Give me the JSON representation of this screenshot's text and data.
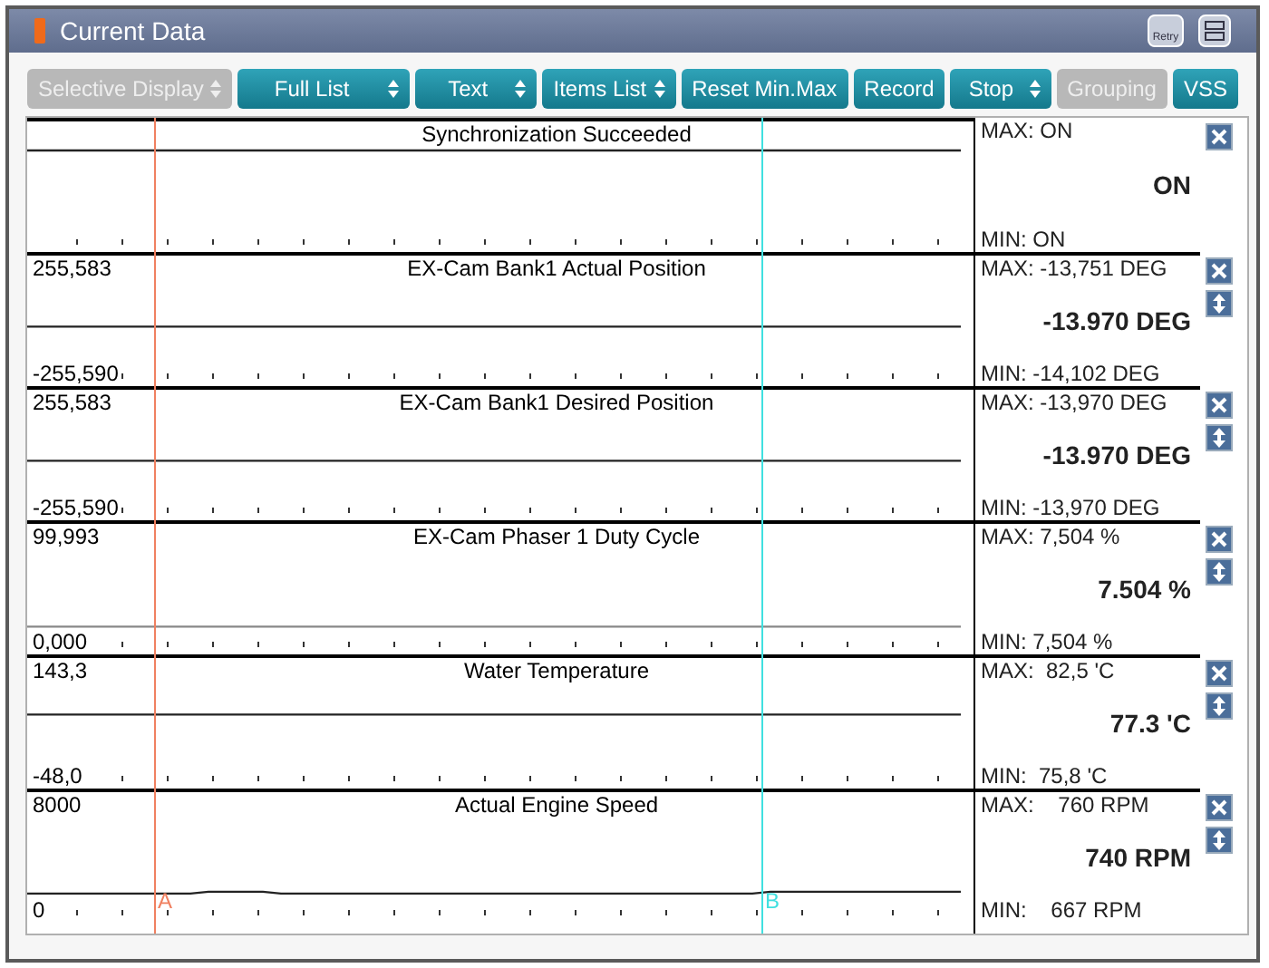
{
  "window": {
    "title": "Current Data",
    "retry_button": "Retry"
  },
  "toolbar": [
    {
      "label": "Selective Display",
      "disabled": true,
      "dropdown": true
    },
    {
      "label": "Full List",
      "disabled": false,
      "dropdown": true
    },
    {
      "label": "Text",
      "disabled": false,
      "dropdown": true
    },
    {
      "label": "Items List",
      "disabled": false,
      "dropdown": true
    },
    {
      "label": "Reset Min.Max",
      "disabled": false,
      "dropdown": false
    },
    {
      "label": "Record",
      "disabled": false,
      "dropdown": false
    },
    {
      "label": "Stop",
      "disabled": false,
      "dropdown": true
    },
    {
      "label": "Grouping",
      "disabled": true,
      "dropdown": false
    },
    {
      "label": "VSS",
      "disabled": false,
      "dropdown": false
    }
  ],
  "cursors": [
    {
      "label": "A",
      "color": "#f08060"
    },
    {
      "label": "B",
      "color": "#40e0e0"
    }
  ],
  "items": [
    {
      "title": "Synchronization Succeeded",
      "max": "MAX: ON",
      "value": "ON",
      "min": "MIN: ON",
      "movable": false
    },
    {
      "title": "EX-Cam Bank1 Actual Position",
      "axis_max": "255,583",
      "axis_min": "-255,590",
      "max": "MAX: -13,751 DEG",
      "value": "-13.970 DEG",
      "min": "MIN: -14,102 DEG",
      "movable": true
    },
    {
      "title": "EX-Cam Bank1 Desired Position",
      "axis_max": "255,583",
      "axis_min": "-255,590",
      "max": "MAX: -13,970 DEG",
      "value": "-13.970 DEG",
      "min": "MIN: -13,970 DEG",
      "movable": true
    },
    {
      "title": "EX-Cam Phaser 1 Duty Cycle",
      "axis_max": "99,993",
      "axis_min": "0,000",
      "max": "MAX: 7,504 %",
      "value": "7.504 %",
      "min": "MIN: 7,504 %",
      "movable": true
    },
    {
      "title": "Water Temperature",
      "axis_max": "143,3",
      "axis_min": "-48,0",
      "max": "MAX:  82,5 'C",
      "value": "77.3 'C",
      "min": "MIN:  75,8 'C",
      "movable": true
    },
    {
      "title": "Actual Engine Speed",
      "axis_max": "8000",
      "axis_min": "0",
      "max": "MAX:    760 RPM",
      "value": "740 RPM",
      "min": "MIN:    667 RPM",
      "movable": true
    }
  ]
}
